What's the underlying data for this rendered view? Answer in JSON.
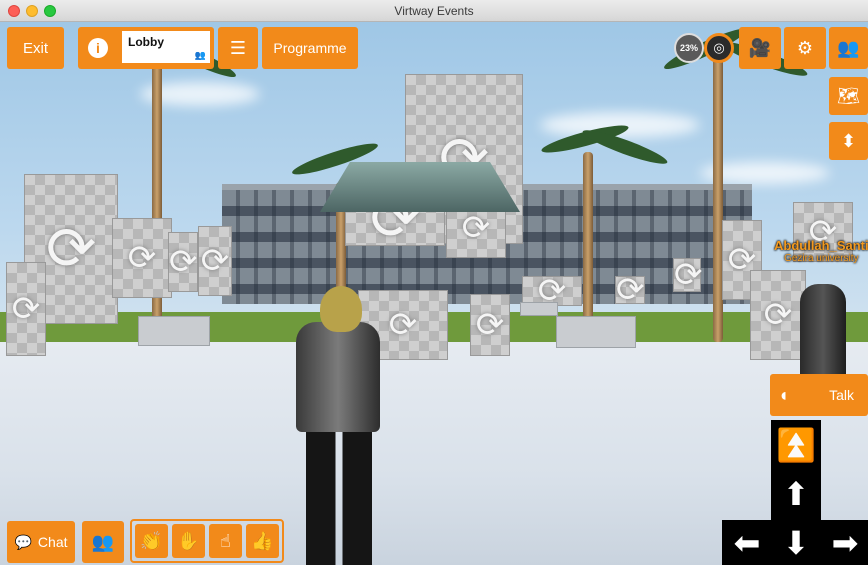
{
  "window": {
    "title": "Virtway Events"
  },
  "toolbar": {
    "exit_label": "Exit",
    "info_icon": "info-icon",
    "location_value": "Lobby",
    "programme_label": "Programme"
  },
  "status": {
    "percent": "23%"
  },
  "npc": {
    "name": "Abdullah_Santi",
    "affiliation": "Gezira university"
  },
  "talk": {
    "label": "Talk"
  },
  "chat": {
    "label": "Chat"
  },
  "colors": {
    "accent": "#f28a1a",
    "text_light": "#ffffff"
  }
}
